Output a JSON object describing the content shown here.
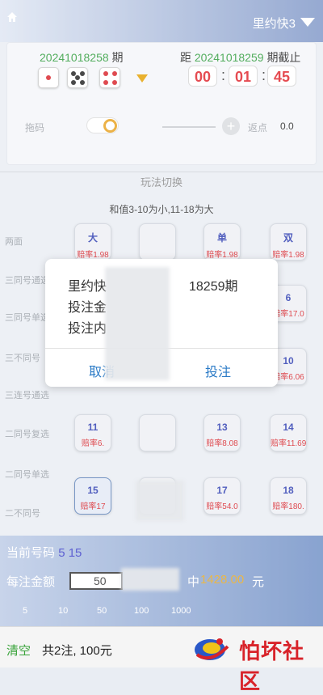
{
  "header": {
    "game_name": "里约快3"
  },
  "period": {
    "current_number": "20241018258",
    "current_suffix": "期",
    "next_prefix": "距",
    "next_number": "20241018259",
    "next_suffix": "期截止",
    "countdown": {
      "h": "00",
      "m": "01",
      "s": "45"
    }
  },
  "settings": {
    "tuo_label": "拖码",
    "rebate_label": "返点",
    "rebate_value": "0.0"
  },
  "switch_label": "玩法切换",
  "rule_text": "和值3-10为小,11-18为大",
  "rows": [
    {
      "label": "两面"
    },
    {
      "label": "三同号通选"
    },
    {
      "label": "三同号单选"
    },
    {
      "label": "三不同号"
    },
    {
      "label": "三连号通选"
    },
    {
      "label": "二同号复选"
    },
    {
      "label": "二同号单选"
    },
    {
      "label": "二不同号"
    }
  ],
  "options": [
    {
      "name": "大",
      "odds": "赔率1.98"
    },
    {
      "name": "单",
      "odds": "赔率1.98"
    },
    {
      "name": "双",
      "odds": "赔率1.98"
    },
    {
      "name": "6",
      "odds": "赔率17.0"
    },
    {
      "name": "10",
      "odds": "赔率6.06"
    },
    {
      "name": "11",
      "odds": "赔率6."
    },
    {
      "name": "13",
      "odds": "赔率8.08"
    },
    {
      "name": "14",
      "odds": "赔率11.69"
    },
    {
      "name": "15",
      "odds": "赔率17"
    },
    {
      "name": "17",
      "odds": "赔率54.0"
    },
    {
      "name": "18",
      "odds": "赔率180."
    }
  ],
  "dialog": {
    "title_start": "里约快",
    "title_period": "18259期",
    "amount_label": "投注金",
    "content_label": "投注内",
    "cancel": "取消",
    "confirm": "投注"
  },
  "bottom": {
    "current_numbers_label": "当前号码",
    "current_numbers": "5 15",
    "per_bet_label": "每注金额",
    "per_bet_value": "50",
    "win_prefix": "中",
    "win_value": "1428.00",
    "win_unit": "元",
    "chips": [
      "5",
      "10",
      "50",
      "100",
      "1000"
    ]
  },
  "footer": {
    "clear": "清空",
    "summary": "共2注, 100元",
    "logo_text": "怕坏社区"
  }
}
